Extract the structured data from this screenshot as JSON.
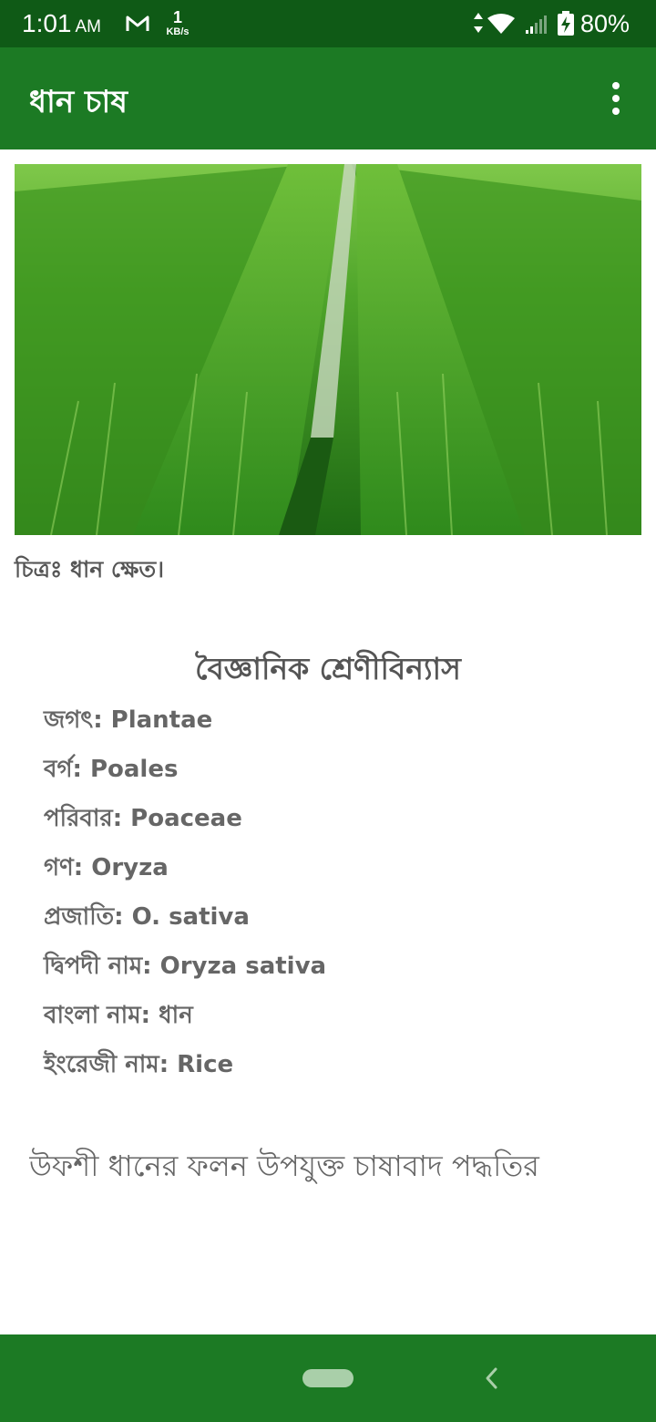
{
  "status_bar": {
    "time": "1:01",
    "ampm": "AM",
    "net_speed_value": "1",
    "net_speed_unit": "KB/s",
    "battery_percent": "80%",
    "icons": [
      "gmail-icon",
      "data-arrows-icon",
      "wifi-icon",
      "signal-icon",
      "battery-charging-icon"
    ]
  },
  "app_bar": {
    "title": "ধান চাষ",
    "overflow_icon": "more-vert-icon"
  },
  "content": {
    "image_caption": "চিত্রঃ ধান ক্ষেত।",
    "section_title": "বৈজ্ঞানিক শ্রেণীবিন্যাস",
    "taxonomy": [
      "জগৎ: Plantae",
      "বর্গ: Poales",
      "পরিবার: Poaceae",
      "গণ: Oryza",
      "প্রজাতি: O. sativa",
      "দ্বিপদী নাম: Oryza sativa",
      "বাংলা নাম: ধান",
      "ইংরেজী নাম: Rice"
    ],
    "body_text": "উফশী ধানের ফলন উপযুক্ত চাষাবাদ পদ্ধতির"
  },
  "nav_bar": {
    "icons": [
      "home-pill-icon",
      "back-chevron-icon"
    ]
  },
  "colors": {
    "status_bar": "#0f5a16",
    "app_bar": "#1c7a24",
    "text_gray": "#555555"
  }
}
